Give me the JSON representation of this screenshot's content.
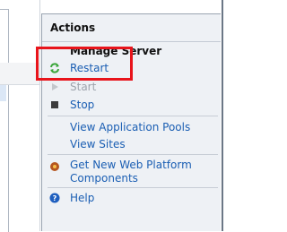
{
  "actions_panel": {
    "header": "Actions",
    "group_title": "Manage Server",
    "items": [
      {
        "label": "Restart",
        "icon": "restart-icon"
      },
      {
        "label": "Start",
        "icon": "start-icon"
      },
      {
        "label": "Stop",
        "icon": "stop-icon"
      },
      {
        "label": "View Application Pools"
      },
      {
        "label": "View Sites"
      },
      {
        "label": "Get New Web Platform",
        "label2": "Components",
        "icon": "web-platform-icon"
      },
      {
        "label": "Help",
        "icon": "help-icon"
      }
    ]
  },
  "colors": {
    "link": "#1a5eb3",
    "disabled": "#9ea4ac",
    "highlight": "#e8141b",
    "panel_bg": "#eef1f5"
  }
}
